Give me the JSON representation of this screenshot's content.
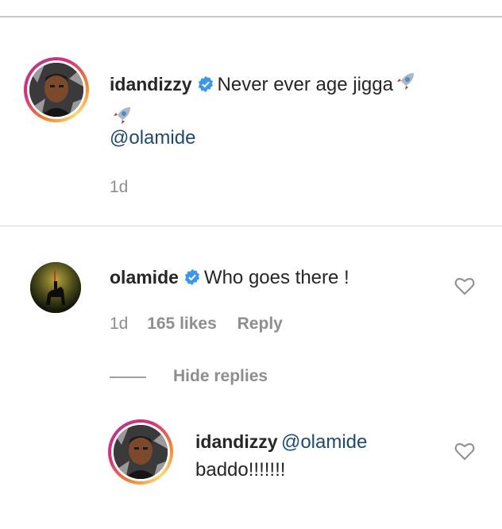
{
  "comment1": {
    "username": "idandizzy",
    "text": "Never ever age jigga",
    "mention": "@olamide",
    "time": "1d"
  },
  "comment2": {
    "username": "olamide",
    "text": "Who goes there !",
    "time": "1d",
    "likes": "165 likes",
    "reply": "Reply",
    "hide_replies": "Hide replies"
  },
  "reply1": {
    "username": "idandizzy",
    "mention": "@olamide",
    "text": "baddo!!!!!!!"
  },
  "colors": {
    "verified": "#3897f0",
    "mention": "#1a4a7a",
    "meta": "#8e8e8e",
    "heart": "#8e8e8e"
  }
}
